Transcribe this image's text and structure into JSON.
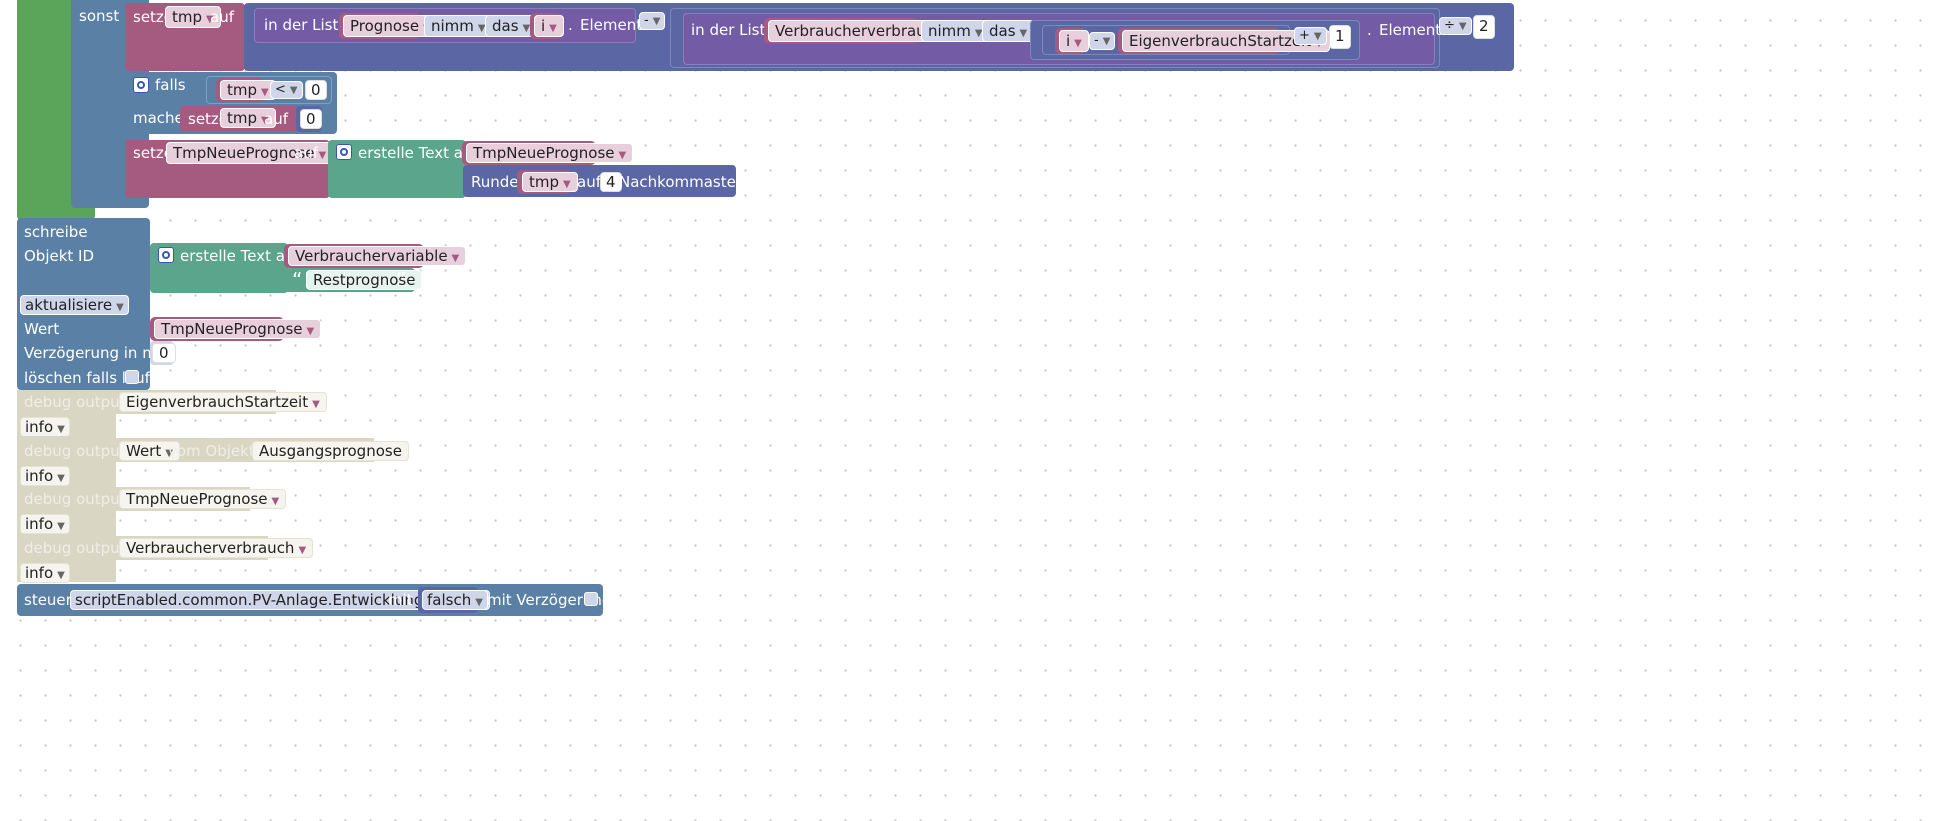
{
  "labels": {
    "sonst": "sonst",
    "setze": "setze",
    "auf": "auf",
    "in_der_liste": "in der Liste",
    "element": "Element",
    "dot": ".",
    "falls": "falls",
    "mache": "mache",
    "erstelle_text_aus": "erstelle Text aus",
    "runde": "Runde",
    "nachkommastellen": "Nachkommastellen",
    "schreibe": "schreibe",
    "objekt_id": "Objekt ID",
    "wert": "Wert",
    "verzoegerung": "Verzögerung in ms",
    "loeschen_falls_laeuft": "löschen falls läuft",
    "debug_output": "debug output",
    "vom_objekt_id": "vom Objekt ID",
    "steuere": "steuere",
    "mit": "mit",
    "mit_verzoegerung": "mit Verzögerung"
  },
  "vars": {
    "tmp": "tmp",
    "prognose": "Prognose",
    "i": "i",
    "verbraucherverbrauch": "Verbraucherverbrauch",
    "eigenverbrauchstartzeit": "EigenverbrauchStartzeit",
    "tmpneueprognose": "TmpNeuePrognose",
    "verbrauchervariable": "Verbrauchervariable"
  },
  "dropdowns": {
    "nimm": "nimm",
    "das": "das",
    "minus": "-",
    "plus": "+",
    "divide": "÷",
    "lt": "<",
    "aktualisiere": "aktualisiere",
    "info": "info",
    "wert": "Wert",
    "falsch": "falsch"
  },
  "values": {
    "one": "1",
    "two": "2",
    "zero": "0",
    "four": "4",
    "delay": "0",
    "restprognose": "Restprognose",
    "ausgangsprognose": "Ausgangsprognose",
    "script_id": "scriptEnabled.common.PV-Anlage.Entwicklung.Progn..."
  },
  "quotes": {
    "open": "“",
    "close": "”"
  },
  "colors": {
    "logic": "#5b80a5",
    "variables": "#a55b80",
    "text": "#5ba58c",
    "math": "#5b67a5",
    "lists": "#745ba5",
    "debug": "#d9d6c4"
  }
}
